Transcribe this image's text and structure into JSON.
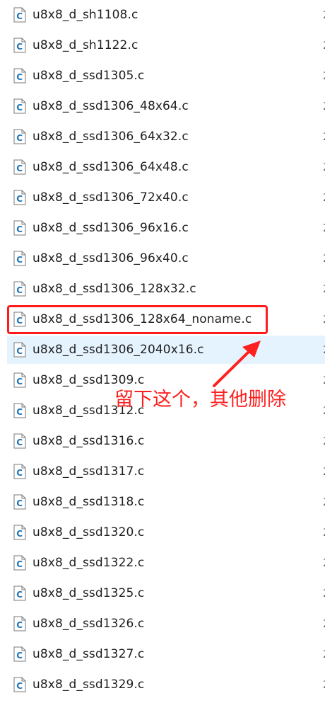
{
  "files": [
    {
      "name": "u8x8_d_sh1108.c"
    },
    {
      "name": "u8x8_d_sh1122.c"
    },
    {
      "name": "u8x8_d_ssd1305.c"
    },
    {
      "name": "u8x8_d_ssd1306_48x64.c"
    },
    {
      "name": "u8x8_d_ssd1306_64x32.c"
    },
    {
      "name": "u8x8_d_ssd1306_64x48.c"
    },
    {
      "name": "u8x8_d_ssd1306_72x40.c"
    },
    {
      "name": "u8x8_d_ssd1306_96x16.c"
    },
    {
      "name": "u8x8_d_ssd1306_96x40.c"
    },
    {
      "name": "u8x8_d_ssd1306_128x32.c"
    },
    {
      "name": "u8x8_d_ssd1306_128x64_noname.c",
      "highlighted": true
    },
    {
      "name": "u8x8_d_ssd1306_2040x16.c",
      "hovered": true
    },
    {
      "name": "u8x8_d_ssd1309.c"
    },
    {
      "name": "u8x8_d_ssd1312.c"
    },
    {
      "name": "u8x8_d_ssd1316.c"
    },
    {
      "name": "u8x8_d_ssd1317.c"
    },
    {
      "name": "u8x8_d_ssd1318.c"
    },
    {
      "name": "u8x8_d_ssd1320.c"
    },
    {
      "name": "u8x8_d_ssd1322.c"
    },
    {
      "name": "u8x8_d_ssd1325.c"
    },
    {
      "name": "u8x8_d_ssd1326.c"
    },
    {
      "name": "u8x8_d_ssd1327.c"
    },
    {
      "name": "u8x8_d_ssd1329.c"
    }
  ],
  "right_column_char": "2",
  "annotation": {
    "text": "留下这个，其他删除",
    "color": "#ff2020"
  },
  "colors": {
    "hover_background": "#e5f3ff",
    "highlight_border": "#ff1b1b",
    "icon_letter": "#1a73b8"
  },
  "icon": "c-source-file-icon"
}
